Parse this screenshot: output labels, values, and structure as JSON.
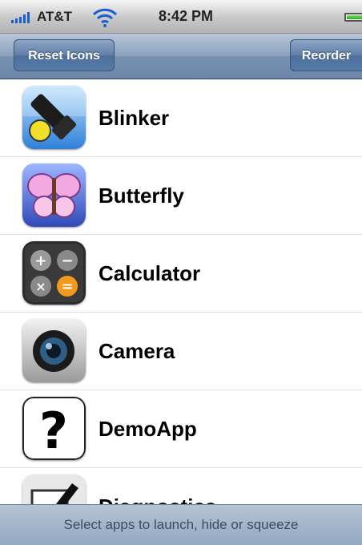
{
  "status_bar": {
    "carrier": "AT&T",
    "time": "8:42 PM"
  },
  "nav": {
    "left_button": "Reset Icons",
    "right_button": "Reorder"
  },
  "apps": [
    {
      "name": "Blinker",
      "icon": "flashlight-icon"
    },
    {
      "name": "Butterfly",
      "icon": "butterfly-icon"
    },
    {
      "name": "Calculator",
      "icon": "calculator-icon"
    },
    {
      "name": "Camera",
      "icon": "camera-icon"
    },
    {
      "name": "DemoApp",
      "icon": "question-mark-icon"
    },
    {
      "name": "Diagnostics",
      "icon": "checkmark-icon"
    }
  ],
  "footer": {
    "text": "Select apps to launch, hide or squeeze"
  }
}
